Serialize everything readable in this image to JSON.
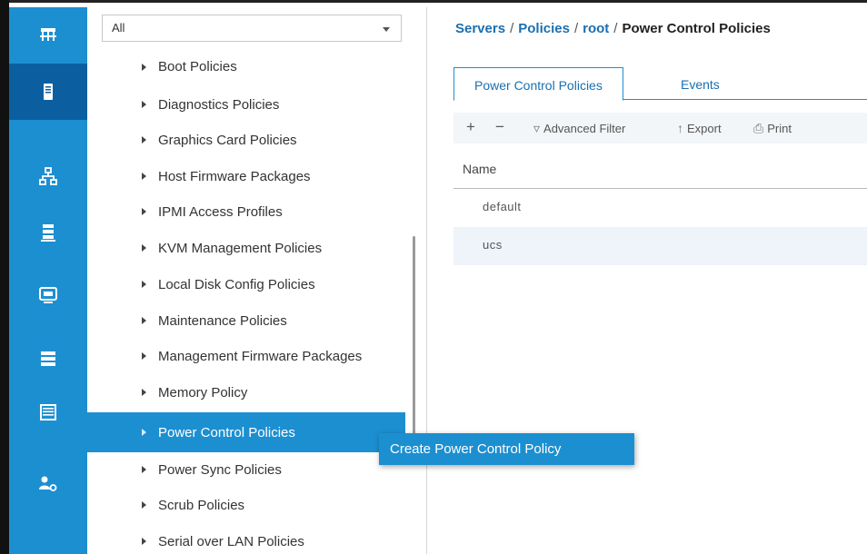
{
  "filter": {
    "value": "All"
  },
  "tree": {
    "items": [
      {
        "label": "Boot Policies"
      },
      {
        "label": "Diagnostics Policies"
      },
      {
        "label": "Graphics Card Policies"
      },
      {
        "label": "Host Firmware Packages"
      },
      {
        "label": "IPMI Access Profiles"
      },
      {
        "label": "KVM Management Policies"
      },
      {
        "label": "Local Disk Config Policies"
      },
      {
        "label": "Maintenance Policies"
      },
      {
        "label": "Management Firmware Packages"
      },
      {
        "label": "Memory Policy"
      },
      {
        "label": "Power Control Policies"
      },
      {
        "label": "Power Sync Policies"
      },
      {
        "label": "Scrub Policies"
      },
      {
        "label": "Serial over LAN Policies"
      }
    ]
  },
  "context_menu": {
    "item": "Create Power Control Policy"
  },
  "breadcrumb": {
    "part1": "Servers",
    "part2": "Policies",
    "part3": "root",
    "current": "Power Control Policies",
    "sep": "/"
  },
  "tabs": {
    "tab1": "Power Control Policies",
    "tab2": "Events"
  },
  "toolbar": {
    "add": "+",
    "remove": "−",
    "filter": "Advanced Filter",
    "export": "Export",
    "print": "Print"
  },
  "table": {
    "header": "Name",
    "rows": [
      {
        "name": "default"
      },
      {
        "name": "ucs"
      }
    ]
  },
  "colors": {
    "accent": "#1c8fd1",
    "accent_dark": "#0b5fa1",
    "link": "#1a6fb0"
  },
  "icons": [
    "network-icon",
    "server-icon",
    "lan-icon",
    "san-icon",
    "vm-icon",
    "storage-icon",
    "chassis-icon",
    "admin-icon"
  ]
}
